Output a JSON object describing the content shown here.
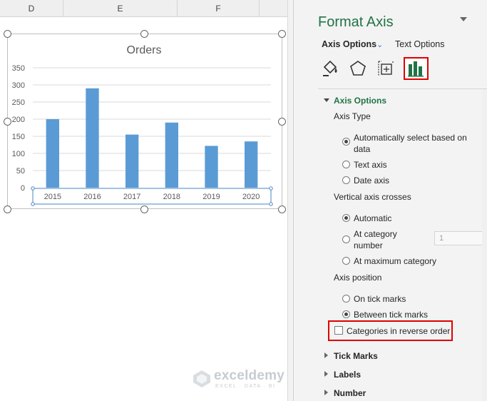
{
  "sheet": {
    "columns": [
      "D",
      "E",
      "F"
    ]
  },
  "chart_data": {
    "type": "bar",
    "title": "Orders",
    "categories": [
      "2015",
      "2016",
      "2017",
      "2018",
      "2019",
      "2020"
    ],
    "values": [
      200,
      290,
      155,
      190,
      122,
      135
    ],
    "ylim": [
      0,
      350
    ],
    "yticks": [
      "0",
      "50",
      "100",
      "150",
      "200",
      "250",
      "300",
      "350"
    ],
    "grid": true,
    "bar_color": "#5b9bd5"
  },
  "watermark": {
    "name": "exceldemy",
    "tagline": "EXCEL · DATA · BI"
  },
  "pane": {
    "title": "Format Axis",
    "tabs": {
      "axis_options": "Axis Options",
      "text_options": "Text Options"
    },
    "icons": [
      "fill-line-icon",
      "effects-icon",
      "size-properties-icon",
      "axis-options-icon"
    ],
    "sections": {
      "axis_options": "Axis Options",
      "axis_type": "Axis Type",
      "auto_select": "Automatically select based on",
      "auto_select_2": "data",
      "text_axis": "Text axis",
      "date_axis": "Date axis",
      "vertical_crosses": "Vertical axis crosses",
      "automatic": "Automatic",
      "at_category": "At category",
      "at_category_2": "number",
      "category_number": "1",
      "at_max": "At maximum category",
      "axis_position": "Axis position",
      "on_tick": "On tick marks",
      "between_tick": "Between tick marks",
      "reverse_order": "Categories in reverse order",
      "tick_marks": "Tick Marks",
      "labels": "Labels",
      "number": "Number"
    },
    "accent": "#217346",
    "highlight": "#e00000"
  }
}
